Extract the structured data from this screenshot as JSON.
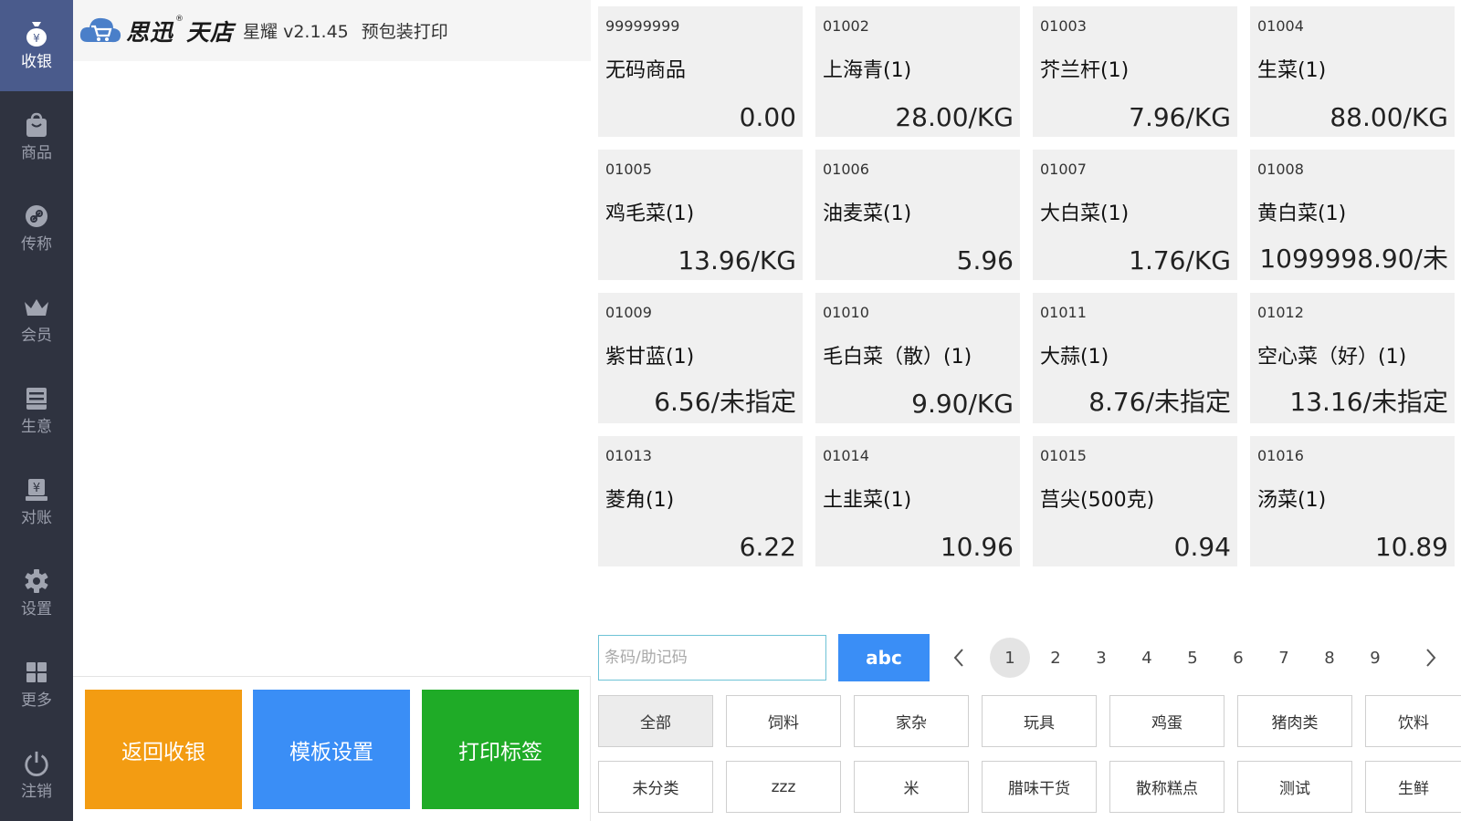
{
  "sidebar": {
    "items": [
      {
        "label": "收银",
        "icon": "moneybag-icon"
      },
      {
        "label": "商品",
        "icon": "shopping-bag-icon"
      },
      {
        "label": "传称",
        "icon": "link-icon"
      },
      {
        "label": "会员",
        "icon": "crown-icon"
      },
      {
        "label": "生意",
        "icon": "ledger-icon"
      },
      {
        "label": "对账",
        "icon": "yen-terminal-icon"
      },
      {
        "label": "设置",
        "icon": "gear-icon"
      },
      {
        "label": "更多",
        "icon": "grid-icon"
      },
      {
        "label": "注销",
        "icon": "power-icon"
      }
    ]
  },
  "header": {
    "brand_left": "思迅",
    "brand_reg": "®",
    "brand_right": "天店",
    "version": "星耀 v2.1.45",
    "mode": "预包装打印"
  },
  "actions": {
    "back": "返回收银",
    "template": "模板设置",
    "print": "打印标签"
  },
  "products": [
    {
      "code": "99999999",
      "name": "无码商品",
      "price": "0.00"
    },
    {
      "code": "01002",
      "name": "上海青(1)",
      "price": "28.00/KG"
    },
    {
      "code": "01003",
      "name": "芥兰杆(1)",
      "price": "7.96/KG"
    },
    {
      "code": "01004",
      "name": "生菜(1)",
      "price": "88.00/KG"
    },
    {
      "code": "01005",
      "name": "鸡毛菜(1)",
      "price": "13.96/KG"
    },
    {
      "code": "01006",
      "name": "油麦菜(1)",
      "price": "5.96"
    },
    {
      "code": "01007",
      "name": "大白菜(1)",
      "price": "1.76/KG"
    },
    {
      "code": "01008",
      "name": "黄白菜(1)",
      "price": "1099998.90/未"
    },
    {
      "code": "01009",
      "name": "紫甘蓝(1)",
      "price": "6.56/未指定"
    },
    {
      "code": "01010",
      "name": "毛白菜（散）(1)",
      "price": "9.90/KG"
    },
    {
      "code": "01011",
      "name": "大蒜(1)",
      "price": "8.76/未指定"
    },
    {
      "code": "01012",
      "name": "空心菜（好）(1)",
      "price": "13.16/未指定"
    },
    {
      "code": "01013",
      "name": "菱角(1)",
      "price": "6.22"
    },
    {
      "code": "01014",
      "name": "土韭菜(1)",
      "price": "10.96"
    },
    {
      "code": "01015",
      "name": "莒尖(500克)",
      "price": "0.94"
    },
    {
      "code": "01016",
      "name": "汤菜(1)",
      "price": "10.89"
    }
  ],
  "search": {
    "placeholder": "条码/助记码",
    "value": ""
  },
  "keyboard_toggle": "abc",
  "pagination": {
    "prev": "<",
    "next": ">",
    "pages": [
      "1",
      "2",
      "3",
      "4",
      "5",
      "6",
      "7",
      "8",
      "9"
    ],
    "current": "1"
  },
  "categories": [
    [
      "全部",
      "饲料",
      "家杂",
      "玩具",
      "鸡蛋",
      "猪肉类",
      "饮料"
    ],
    [
      "未分类",
      "zzz",
      "米",
      "腊味干货",
      "散称糕点",
      "测试",
      "生鲜"
    ]
  ]
}
